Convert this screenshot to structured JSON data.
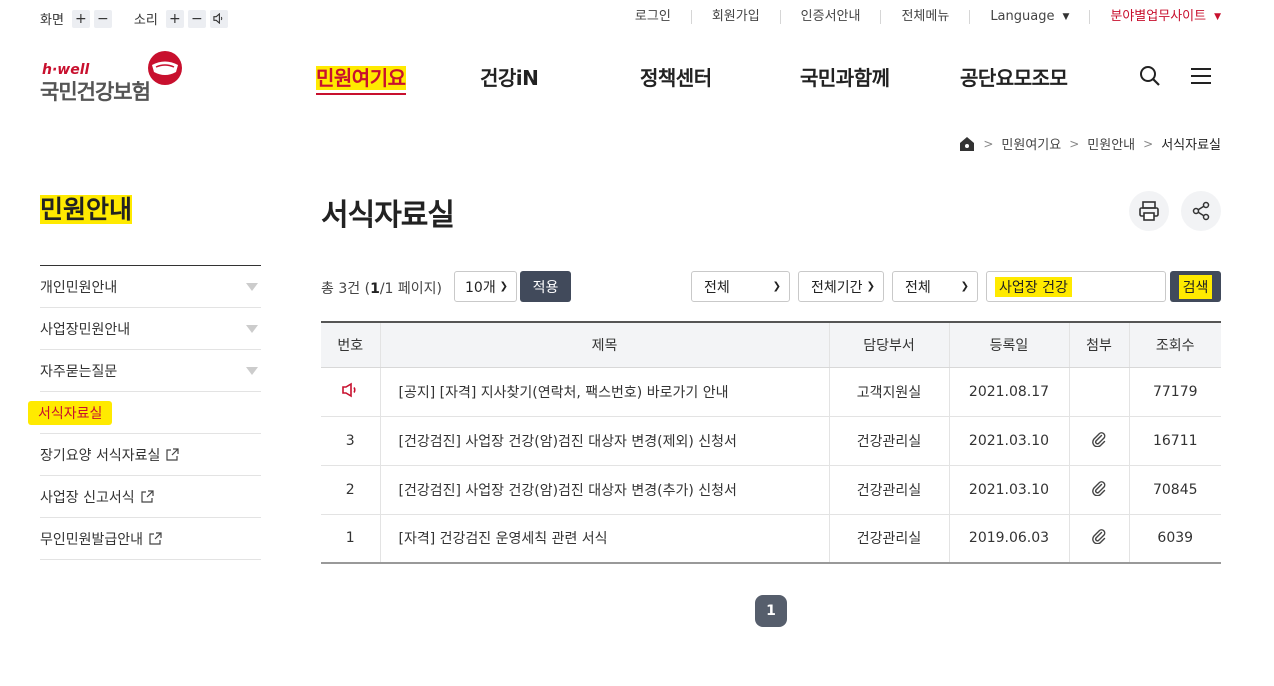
{
  "util": {
    "screen_label": "화면",
    "sound_label": "소리",
    "plus": "+",
    "minus": "−",
    "links": [
      "로그인",
      "회원가입",
      "인증서안내",
      "전체메뉴",
      "Language",
      "분야별업무사이트"
    ]
  },
  "logo": {
    "sub": "h·well",
    "name": "국민건강보험"
  },
  "gnb": [
    "민원여기요",
    "건강iN",
    "정책센터",
    "국민과함께",
    "공단요모조모"
  ],
  "breadcrumb": [
    "민원여기요",
    "민원안내",
    "서식자료실"
  ],
  "lnb": {
    "title": "민원안내",
    "items": [
      "개인민원안내",
      "사업장민원안내",
      "자주묻는질문",
      "서식자료실",
      "장기요양 서식자료실",
      "사업장 신고서식",
      "무인민원발급안내"
    ]
  },
  "page_title": "서식자료실",
  "list": {
    "count_prefix": "총 ",
    "count": "3",
    "count_suffix": "건 (",
    "page_cur": "1",
    "page_total": "/1 페이지)",
    "per_page": "10개",
    "apply": "적용",
    "filter1": "전체",
    "filter2": "전체기간",
    "filter3": "전체",
    "search_value": "사업장 건강",
    "search_btn": "검색"
  },
  "table": {
    "headers": [
      "번호",
      "제목",
      "담당부서",
      "등록일",
      "첨부",
      "조회수"
    ],
    "rows": [
      {
        "no": "",
        "title": "[공지] [자격] 지사찾기(연락처, 팩스번호) 바로가기 안내",
        "dept": "고객지원실",
        "date": "2021.08.17",
        "views": "77179"
      },
      {
        "no": "3",
        "title": "[건강검진] 사업장 건강(암)검진 대상자 변경(제외) 신청서",
        "dept": "건강관리실",
        "date": "2021.03.10",
        "views": "16711"
      },
      {
        "no": "2",
        "title": "[건강검진] 사업장 건강(암)검진 대상자 변경(추가) 신청서",
        "dept": "건강관리실",
        "date": "2021.03.10",
        "views": "70845"
      },
      {
        "no": "1",
        "title": "[자격] 건강검진 운영세칙 관련 서식",
        "dept": "건강관리실",
        "date": "2019.06.03",
        "views": "6039"
      }
    ]
  },
  "pager": {
    "current": "1"
  },
  "colors": {
    "accent_red": "#c8102e",
    "highlight": "#ffea00",
    "dark_btn": "#414a5b"
  }
}
